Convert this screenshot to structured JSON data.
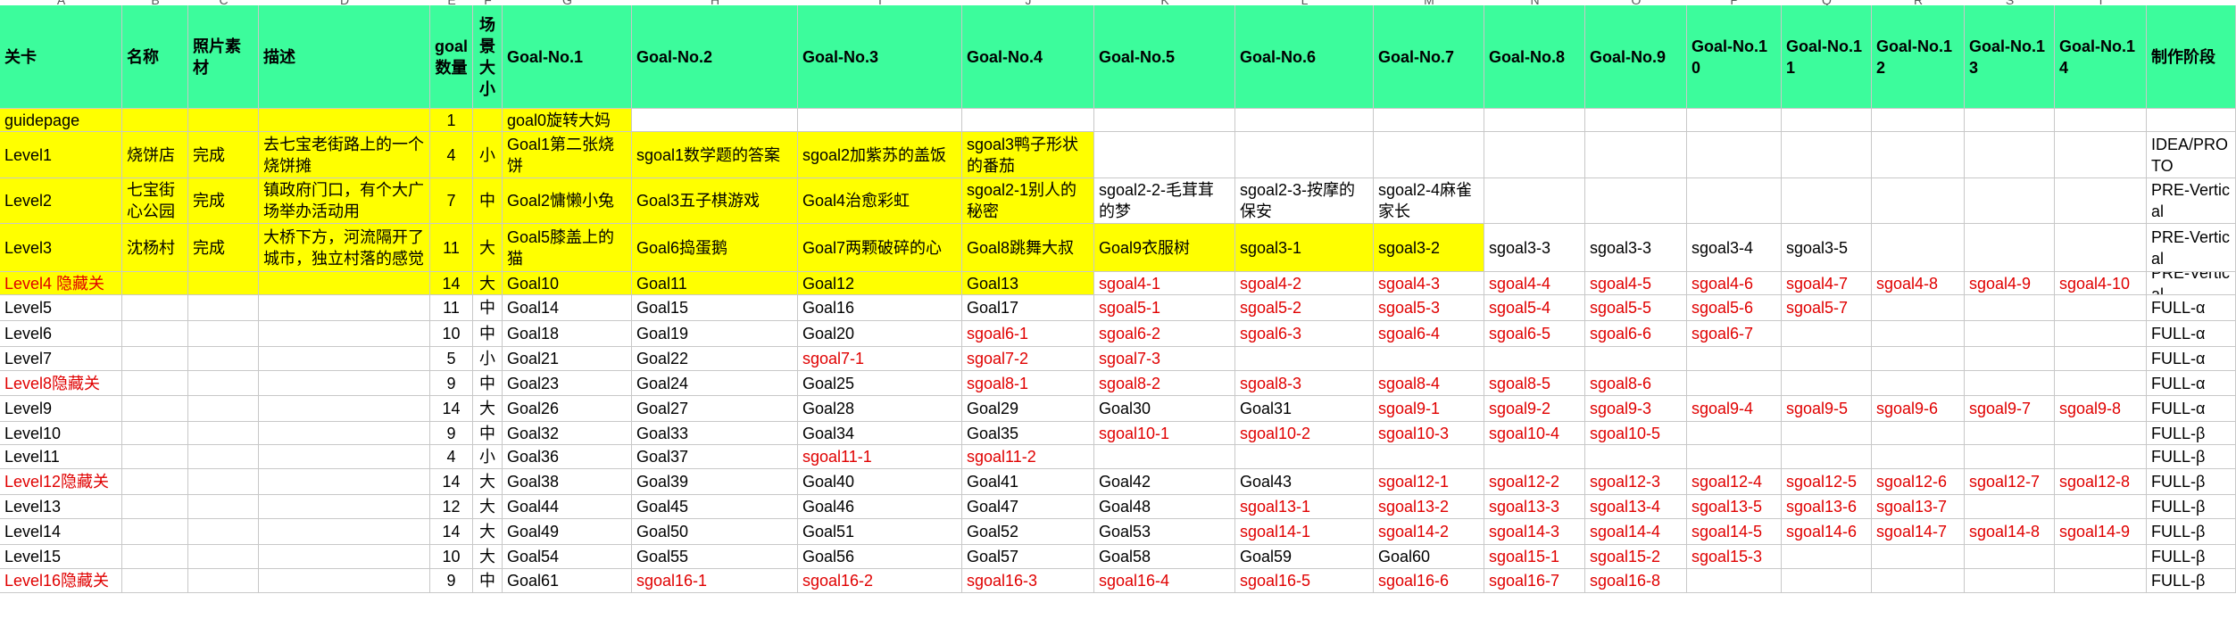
{
  "column_letters": [
    "A",
    "B",
    "C",
    "D",
    "E",
    "F",
    "G",
    "H",
    "I",
    "J",
    "K",
    "L",
    "M",
    "N",
    "O",
    "P",
    "Q",
    "R",
    "S",
    "T"
  ],
  "header": [
    "关卡",
    "名称",
    "照片素材",
    "描述",
    "goal数量",
    "场景大小",
    "Goal-No.1",
    "Goal-No.2",
    "Goal-No.3",
    "Goal-No.4",
    "Goal-No.5",
    "Goal-No.6",
    "Goal-No.7",
    "Goal-No.8",
    "Goal-No.9",
    "Goal-No.10",
    "Goal-No.11",
    "Goal-No.12",
    "Goal-No.13",
    "Goal-No.14",
    "制作阶段"
  ],
  "rows": [
    [
      "guidepage",
      "",
      "",
      "",
      "1",
      "",
      "goal0旋转大妈",
      "",
      "",
      "",
      "",
      "",
      "",
      "",
      "",
      "",
      "",
      "",
      "",
      "",
      ""
    ],
    [
      "Level1",
      "烧饼店",
      "完成",
      "去七宝老街路上的一个烧饼摊",
      "4",
      "小",
      "Goal1第二张烧饼",
      "sgoal1数学题的答案",
      "sgoal2加紫苏的盖饭",
      "sgoal3鸭子形状的番茄",
      "",
      "",
      "",
      "",
      "",
      "",
      "",
      "",
      "",
      "",
      "IDEA/PROTO"
    ],
    [
      "Level2",
      "七宝街心公园",
      "完成",
      "镇政府门口，有个大广场举办活动用",
      "7",
      "中",
      "Goal2慵懒小兔",
      "Goal3五子棋游戏",
      "Goal4治愈彩虹",
      "sgoal2-1别人的秘密",
      "sgoal2-2-毛茸茸的梦",
      "sgoal2-3-按摩的保安",
      "sgoal2-4麻雀家长",
      "",
      "",
      "",
      "",
      "",
      "",
      "",
      "PRE-Vertical"
    ],
    [
      "Level3",
      "沈杨村",
      "完成",
      "大桥下方，河流隔开了城市，独立村落的感觉",
      "11",
      "大",
      "Goal5膝盖上的猫",
      "Goal6捣蛋鹅",
      "Goal7两颗破碎的心",
      "Goal8跳舞大叔",
      "Goal9衣服树",
      "sgoal3-1",
      "sgoal3-2",
      "sgoal3-3",
      "sgoal3-3",
      "sgoal3-4",
      "sgoal3-5",
      "",
      "",
      "",
      "PRE-Vertical"
    ],
    [
      "Level4 隐藏关",
      "",
      "",
      "",
      "14",
      "大",
      "Goal10",
      "Goal11",
      "Goal12",
      "Goal13",
      "sgoal4-1",
      "sgoal4-2",
      "sgoal4-3",
      "sgoal4-4",
      "sgoal4-5",
      "sgoal4-6",
      "sgoal4-7",
      "sgoal4-8",
      "sgoal4-9",
      "sgoal4-10",
      "PRE-Vertical"
    ],
    [
      "Level5",
      "",
      "",
      "",
      "11",
      "中",
      "Goal14",
      "Goal15",
      "Goal16",
      "Goal17",
      "sgoal5-1",
      "sgoal5-2",
      "sgoal5-3",
      "sgoal5-4",
      "sgoal5-5",
      "sgoal5-6",
      "sgoal5-7",
      "",
      "",
      "",
      "FULL-α"
    ],
    [
      "Level6",
      "",
      "",
      "",
      "10",
      "中",
      "Goal18",
      "Goal19",
      "Goal20",
      "sgoal6-1",
      "sgoal6-2",
      "sgoal6-3",
      "sgoal6-4",
      "sgoal6-5",
      "sgoal6-6",
      "sgoal6-7",
      "",
      "",
      "",
      "",
      "FULL-α"
    ],
    [
      "Level7",
      "",
      "",
      "",
      "5",
      "小",
      "Goal21",
      "Goal22",
      "sgoal7-1",
      "sgoal7-2",
      "sgoal7-3",
      "",
      "",
      "",
      "",
      "",
      "",
      "",
      "",
      "",
      "FULL-α"
    ],
    [
      "Level8隐藏关",
      "",
      "",
      "",
      "9",
      "中",
      "Goal23",
      "Goal24",
      "Goal25",
      "sgoal8-1",
      "sgoal8-2",
      "sgoal8-3",
      "sgoal8-4",
      "sgoal8-5",
      "sgoal8-6",
      "",
      "",
      "",
      "",
      "",
      "FULL-α"
    ],
    [
      "Level9",
      "",
      "",
      "",
      "14",
      "大",
      "Goal26",
      "Goal27",
      "Goal28",
      "Goal29",
      "Goal30",
      "Goal31",
      "sgoal9-1",
      "sgoal9-2",
      "sgoal9-3",
      "sgoal9-4",
      "sgoal9-5",
      "sgoal9-6",
      "sgoal9-7",
      "sgoal9-8",
      "FULL-α"
    ],
    [
      "Level10",
      "",
      "",
      "",
      "9",
      "中",
      "Goal32",
      "Goal33",
      "Goal34",
      "Goal35",
      "sgoal10-1",
      "sgoal10-2",
      "sgoal10-3",
      "sgoal10-4",
      "sgoal10-5",
      "",
      "",
      "",
      "",
      "",
      "FULL-β"
    ],
    [
      "Level11",
      "",
      "",
      "",
      "4",
      "小",
      "Goal36",
      "Goal37",
      "sgoal11-1",
      "sgoal11-2",
      "",
      "",
      "",
      "",
      "",
      "",
      "",
      "",
      "",
      "",
      "FULL-β"
    ],
    [
      "Level12隐藏关",
      "",
      "",
      "",
      "14",
      "大",
      "Goal38",
      "Goal39",
      "Goal40",
      "Goal41",
      "Goal42",
      "Goal43",
      "sgoal12-1",
      "sgoal12-2",
      "sgoal12-3",
      "sgoal12-4",
      "sgoal12-5",
      "sgoal12-6",
      "sgoal12-7",
      "sgoal12-8",
      "FULL-β"
    ],
    [
      "Level13",
      "",
      "",
      "",
      "12",
      "大",
      "Goal44",
      "Goal45",
      "Goal46",
      "Goal47",
      "Goal48",
      "sgoal13-1",
      "sgoal13-2",
      "sgoal13-3",
      "sgoal13-4",
      "sgoal13-5",
      "sgoal13-6",
      "sgoal13-7",
      "",
      "",
      "FULL-β"
    ],
    [
      "Level14",
      "",
      "",
      "",
      "14",
      "大",
      "Goal49",
      "Goal50",
      "Goal51",
      "Goal52",
      "Goal53",
      "sgoal14-1",
      "sgoal14-2",
      "sgoal14-3",
      "sgoal14-4",
      "sgoal14-5",
      "sgoal14-6",
      "sgoal14-7",
      "sgoal14-8",
      "sgoal14-9",
      "FULL-β"
    ],
    [
      "Level15",
      "",
      "",
      "",
      "10",
      "大",
      "Goal54",
      "Goal55",
      "Goal56",
      "Goal57",
      "Goal58",
      "Goal59",
      "Goal60",
      "sgoal15-1",
      "sgoal15-2",
      "sgoal15-3",
      "",
      "",
      "",
      "",
      "FULL-β"
    ],
    [
      "Level16隐藏关",
      "",
      "",
      "",
      "9",
      "中",
      "Goal61",
      "sgoal16-1",
      "sgoal16-2",
      "sgoal16-3",
      "sgoal16-4",
      "sgoal16-5",
      "sgoal16-6",
      "sgoal16-7",
      "sgoal16-8",
      "",
      "",
      "",
      "",
      "",
      "FULL-β"
    ]
  ],
  "colors": {
    "header_bg": "#3cfc9c",
    "highlight_bg": "#ffff00",
    "red_text": "#e00000",
    "gridline": "#c8c8c8"
  }
}
